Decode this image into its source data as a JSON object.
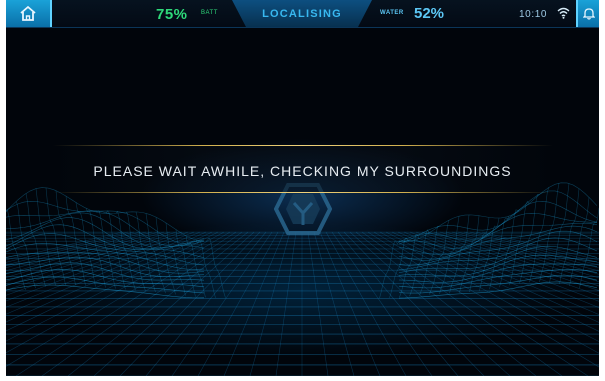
{
  "topbar": {
    "battery_value": "75%",
    "battery_label": "BATT",
    "status": "LOCALISING",
    "water_label": "WATER",
    "water_value": "52%",
    "time": "10:10"
  },
  "message": "PLEASE WAIT AWHILE, CHECKING MY SURROUNDINGS",
  "icons": {
    "home": "home-icon",
    "wifi": "wifi-icon",
    "bell": "bell-icon",
    "emblem": "emblem-icon"
  },
  "colors": {
    "battery": "#2ed97a",
    "water": "#5cc7f5",
    "accent": "#1aa2d8",
    "status": "#38b8f0",
    "gold": "#d1b04e"
  }
}
